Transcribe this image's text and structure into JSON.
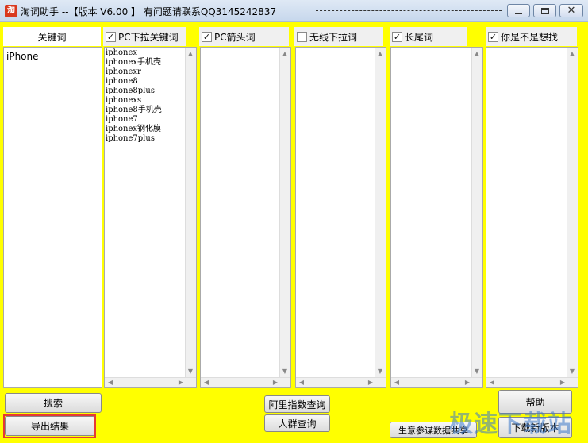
{
  "window": {
    "title": "淘词助手  --【版本 V6.00  】  有问题请联系QQ3145242837",
    "icon": "app-logo-icon"
  },
  "keyword_column": {
    "header": "关键词",
    "items": [
      "iPhone"
    ]
  },
  "columns": [
    {
      "label": "PC下拉关键词",
      "checked": true,
      "items": [
        "iphonex",
        "iphonex手机壳",
        "iphonexr",
        "iphone8",
        "iphone8plus",
        "iphonexs",
        "iphone8手机壳",
        "iphone7",
        "iphonex钢化膜",
        "iphone7plus"
      ]
    },
    {
      "label": "PC箭头词",
      "checked": true,
      "items": []
    },
    {
      "label": "无线下拉词",
      "checked": false,
      "items": []
    },
    {
      "label": "长尾词",
      "checked": true,
      "items": []
    },
    {
      "label": "你是不是想找",
      "checked": true,
      "items": []
    }
  ],
  "buttons": {
    "search": "搜索",
    "export": "导出结果",
    "ali_index": "阿里指数查询",
    "crowd": "人群查询",
    "help": "帮助",
    "download": "下载新版本",
    "business": "生意参谋数据共享"
  },
  "watermark": "极速下载站",
  "colors": {
    "background": "#ffff00",
    "highlight_outline": "#e53935"
  }
}
